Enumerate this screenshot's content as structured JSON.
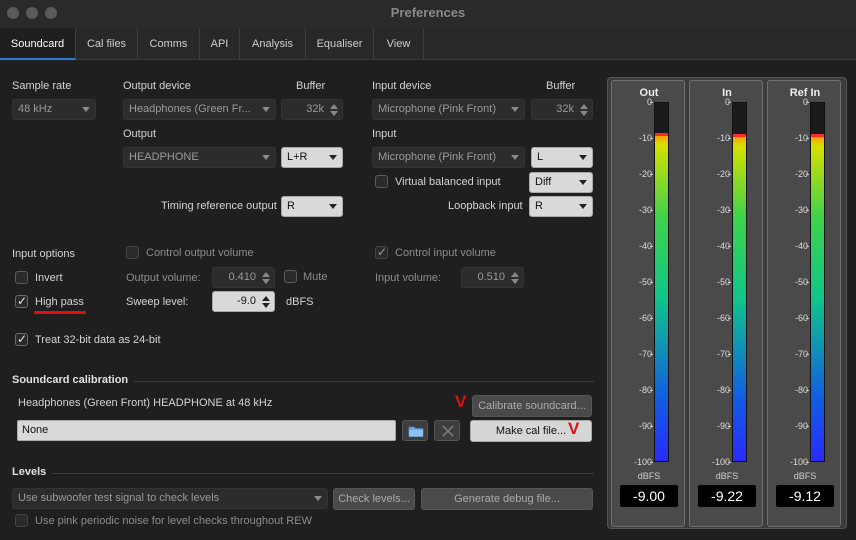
{
  "window": {
    "title": "Preferences"
  },
  "tabs": [
    "Soundcard",
    "Cal files",
    "Comms",
    "API",
    "Analysis",
    "Equaliser",
    "View"
  ],
  "sample_rate": {
    "label": "Sample rate",
    "value": "48 kHz"
  },
  "output": {
    "device_label": "Output device",
    "device_value": "Headphones (Green Fr...",
    "buffer_label": "Buffer",
    "buffer_value": "32k",
    "output_label": "Output",
    "output_value": "HEADPHONE",
    "channel_value": "L+R",
    "timing_label": "Timing reference output",
    "timing_value": "R"
  },
  "input": {
    "device_label": "Input device",
    "device_value": "Microphone (Pink Front)",
    "buffer_label": "Buffer",
    "buffer_value": "32k",
    "input_label": "Input",
    "input_value": "Microphone (Pink Front)",
    "channel_value": "L",
    "virtual_label": "Virtual balanced input",
    "virtual_value": "Diff",
    "loopback_label": "Loopback input",
    "loopback_value": "R"
  },
  "input_options": {
    "title": "Input options",
    "invert_label": "Invert",
    "high_pass_label": "High pass",
    "treat_label": "Treat 32-bit data as 24-bit"
  },
  "output_volume": {
    "control_label": "Control output volume",
    "volume_label": "Output volume:",
    "volume_value": "0.410",
    "mute_label": "Mute",
    "sweep_label": "Sweep level:",
    "sweep_value": "-9.0",
    "sweep_unit": "dBFS"
  },
  "input_volume": {
    "control_label": "Control input volume",
    "volume_label": "Input volume:",
    "volume_value": "0.510"
  },
  "calibration": {
    "title": "Soundcard calibration",
    "status": "Headphones (Green Front) HEADPHONE at 48 kHz",
    "calibrate_label": "Calibrate soundcard...",
    "cal_file_value": "None",
    "make_cal_label": "Make cal file...",
    "annotation_mark": "V"
  },
  "levels": {
    "title": "Levels",
    "signal_value": "Use subwoofer test signal to check levels",
    "check_label": "Check levels...",
    "debug_label": "Generate debug file...",
    "pink_label": "Use pink periodic noise for level checks throughout REW"
  },
  "meters": {
    "scale": [
      "0",
      "-10",
      "-20",
      "-30",
      "-40",
      "-50",
      "-60",
      "-70",
      "-80",
      "-90",
      "-100"
    ],
    "unit": "dBFS",
    "items": [
      {
        "name": "Out",
        "level_dbfs": -9.0,
        "readout": "-9.00"
      },
      {
        "name": "In",
        "level_dbfs": -9.22,
        "readout": "-9.22"
      },
      {
        "name": "Ref In",
        "level_dbfs": -9.12,
        "readout": "-9.12"
      }
    ]
  },
  "colors": {
    "accent": "#2c7ad6",
    "annotation": "#e01010",
    "peak": "#ff2a2a"
  }
}
